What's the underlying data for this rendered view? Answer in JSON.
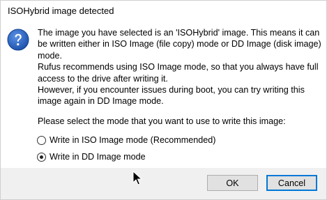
{
  "window": {
    "title": "ISOHybrid image detected"
  },
  "icon": "question-icon",
  "message": {
    "paragraph1": "The image you have selected is an 'ISOHybrid' image. This means it can be written either in ISO Image (file copy) mode or DD Image (disk image) mode.",
    "paragraph2": "Rufus recommends using ISO Image mode, so that you always have full access to the drive after writing it.",
    "paragraph3": "However, if you encounter issues during boot, you can try writing this image again in DD Image mode.",
    "prompt": "Please select the mode that you want to use to write this image:"
  },
  "options": [
    {
      "label": "Write in ISO Image mode (Recommended)",
      "selected": false
    },
    {
      "label": "Write in DD Image mode",
      "selected": true
    }
  ],
  "buttons": {
    "ok": "OK",
    "cancel": "Cancel"
  },
  "colors": {
    "icon_blue": "#1e57b3",
    "focus_border": "#0078d7",
    "footer_bg": "#f0f0f0"
  }
}
